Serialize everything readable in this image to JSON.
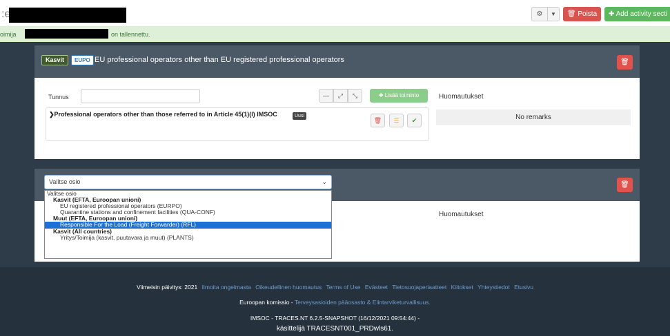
{
  "header": {
    "title_prefix": ":e",
    "settings_icon": "gear-icon",
    "caret_icon": "caret-down-icon",
    "delete_label": "Poista",
    "add_section_label": "Add activity secti"
  },
  "alert": {
    "prefix": "oimija",
    "suffix": "on tallennettu."
  },
  "panel1": {
    "badge_kasvit": "Kasvit",
    "badge_eupo": "EUPO",
    "title": "EU professional operators other than EU registered professional operators",
    "tunnus_label": "Tunnus",
    "tunnus_value": "",
    "lisaa_label": "Lisää toiminto",
    "huomautukset_label": "Huomautukset",
    "operator_title": "Professional operators other than those referred to in Article 45(1)(l) IMSOC",
    "new_badge": "Uusi",
    "remarks": "No remarks"
  },
  "panel2": {
    "select_value": "Valitse osio",
    "huomautukset_label": "Huomautukset"
  },
  "dropdown": {
    "placeholder": "Valitse osio",
    "groups": [
      {
        "label": "Kasvit (EFTA, Euroopan unioni)",
        "options": [
          "EU registered professional operators (EURPO)",
          "Quarantine stations and confinement facilities (QUA-CONF)"
        ]
      },
      {
        "label": "Muut (EFTA, Euroopan unioni)",
        "options": [
          "Responsible For the Load (Freight Forwarder) (RFL)"
        ]
      },
      {
        "label": "Kasvit (All countries)",
        "options": [
          "Yritys/Toimija (kasvit, puutavara ja muut) (PLANTS)"
        ]
      }
    ],
    "selected_option": "Responsible For the Load (Freight Forwarder) (RFL)"
  },
  "footer": {
    "last_updated": "Viimeisin päivitys: 2021",
    "links": [
      "Ilmoita ongelmasta",
      "Oikeudellinen huomautus",
      "Terms of Use",
      "Evästeet",
      "Tietosuojaperiaatteet",
      "Kiitokset",
      "Yhteystiedot",
      "Etusivu"
    ],
    "commission": "Euroopan komissio -",
    "commission_link": "Terveysasioiden pääosasto & Elintarviketurvallisuus.",
    "version": "IMSOC - TRACES.NT 6.2.5-SNAPSHOT (16/12/2021 09:54:44) -",
    "user": "käsittelijä TRACESNT001_PRDwls61."
  },
  "colors": {
    "main_bg": "#2e3b48",
    "panel_head": "#4b5967",
    "danger": "#d9534f",
    "success": "#5cb85c",
    "alert_bg": "#dff0d8",
    "selected_option": "#1f70d6",
    "footer_link": "#6f9dcf"
  }
}
